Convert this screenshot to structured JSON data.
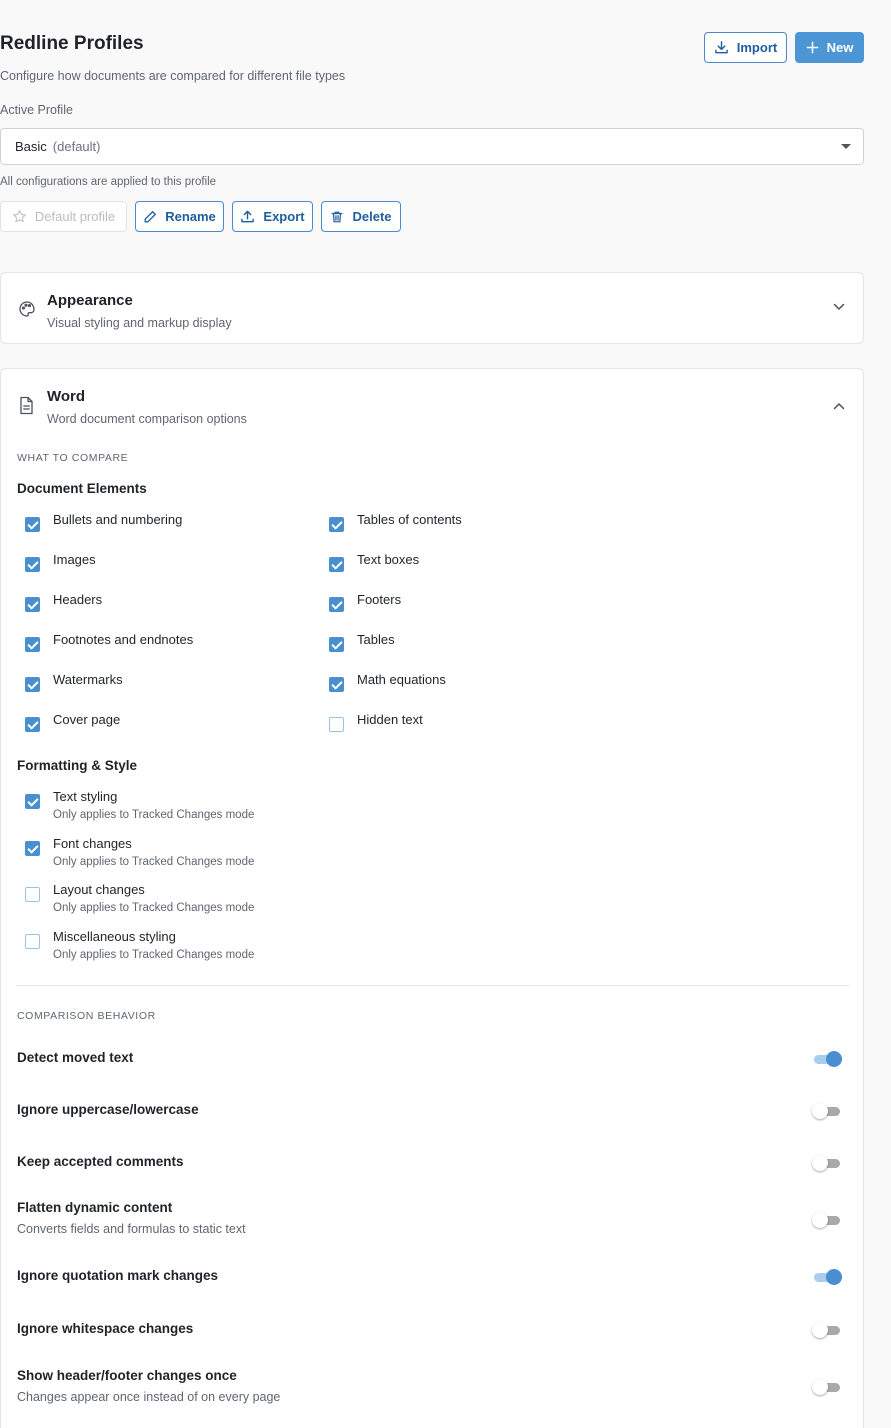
{
  "header": {
    "title": "Redline Profiles",
    "subtitle": "Configure how documents are compared for different file types",
    "import_label": "Import",
    "new_label": "New"
  },
  "profile": {
    "label": "Active Profile",
    "selected": "Basic",
    "selected_suffix": "(default)",
    "helper": "All configurations are applied to this profile",
    "actions": {
      "default_label": "Default profile",
      "rename_label": "Rename",
      "export_label": "Export",
      "delete_label": "Delete"
    }
  },
  "appearance": {
    "title": "Appearance",
    "subtitle": "Visual styling and markup display",
    "icon": "palette-icon",
    "expanded": false
  },
  "word": {
    "title": "Word",
    "subtitle": "Word document comparison options",
    "icon": "document-icon",
    "expanded": true,
    "what_to_compare": "WHAT TO COMPARE",
    "elements_title": "Document Elements",
    "elements": [
      {
        "label": "Bullets and numbering",
        "checked": true
      },
      {
        "label": "Tables of contents",
        "checked": true
      },
      {
        "label": "Images",
        "checked": true
      },
      {
        "label": "Text boxes",
        "checked": true
      },
      {
        "label": "Headers",
        "checked": true
      },
      {
        "label": "Footers",
        "checked": true
      },
      {
        "label": "Footnotes and endnotes",
        "checked": true
      },
      {
        "label": "Tables",
        "checked": true
      },
      {
        "label": "Watermarks",
        "checked": true
      },
      {
        "label": "Math equations",
        "checked": true
      },
      {
        "label": "Cover page",
        "checked": true
      },
      {
        "label": "Hidden text",
        "checked": false
      }
    ],
    "formatting_title": "Formatting & Style",
    "formatting": [
      {
        "label": "Text styling",
        "desc": "Only applies to Tracked Changes mode",
        "checked": true
      },
      {
        "label": "Font changes",
        "desc": "Only applies to Tracked Changes mode",
        "checked": true
      },
      {
        "label": "Layout changes",
        "desc": "Only applies to Tracked Changes mode",
        "checked": false
      },
      {
        "label": "Miscellaneous styling",
        "desc": "Only applies to Tracked Changes mode",
        "checked": false
      }
    ],
    "behavior_head": "COMPARISON BEHAVIOR",
    "behavior": [
      {
        "label": "Detect moved text",
        "desc": "",
        "on": true
      },
      {
        "label": "Ignore uppercase/lowercase",
        "desc": "",
        "on": false
      },
      {
        "label": "Keep accepted comments",
        "desc": "",
        "on": false
      },
      {
        "label": "Flatten dynamic content",
        "desc": "Converts fields and formulas to static text",
        "on": false
      },
      {
        "label": "Ignore quotation mark changes",
        "desc": "",
        "on": true
      },
      {
        "label": "Ignore whitespace changes",
        "desc": "",
        "on": false
      },
      {
        "label": "Show header/footer changes once",
        "desc": "Changes appear once instead of on every page",
        "on": false
      }
    ]
  },
  "colors": {
    "accent": "#4d96d6",
    "accent_border": "#4b89c8",
    "checkbox_on": "#4a90d0"
  }
}
